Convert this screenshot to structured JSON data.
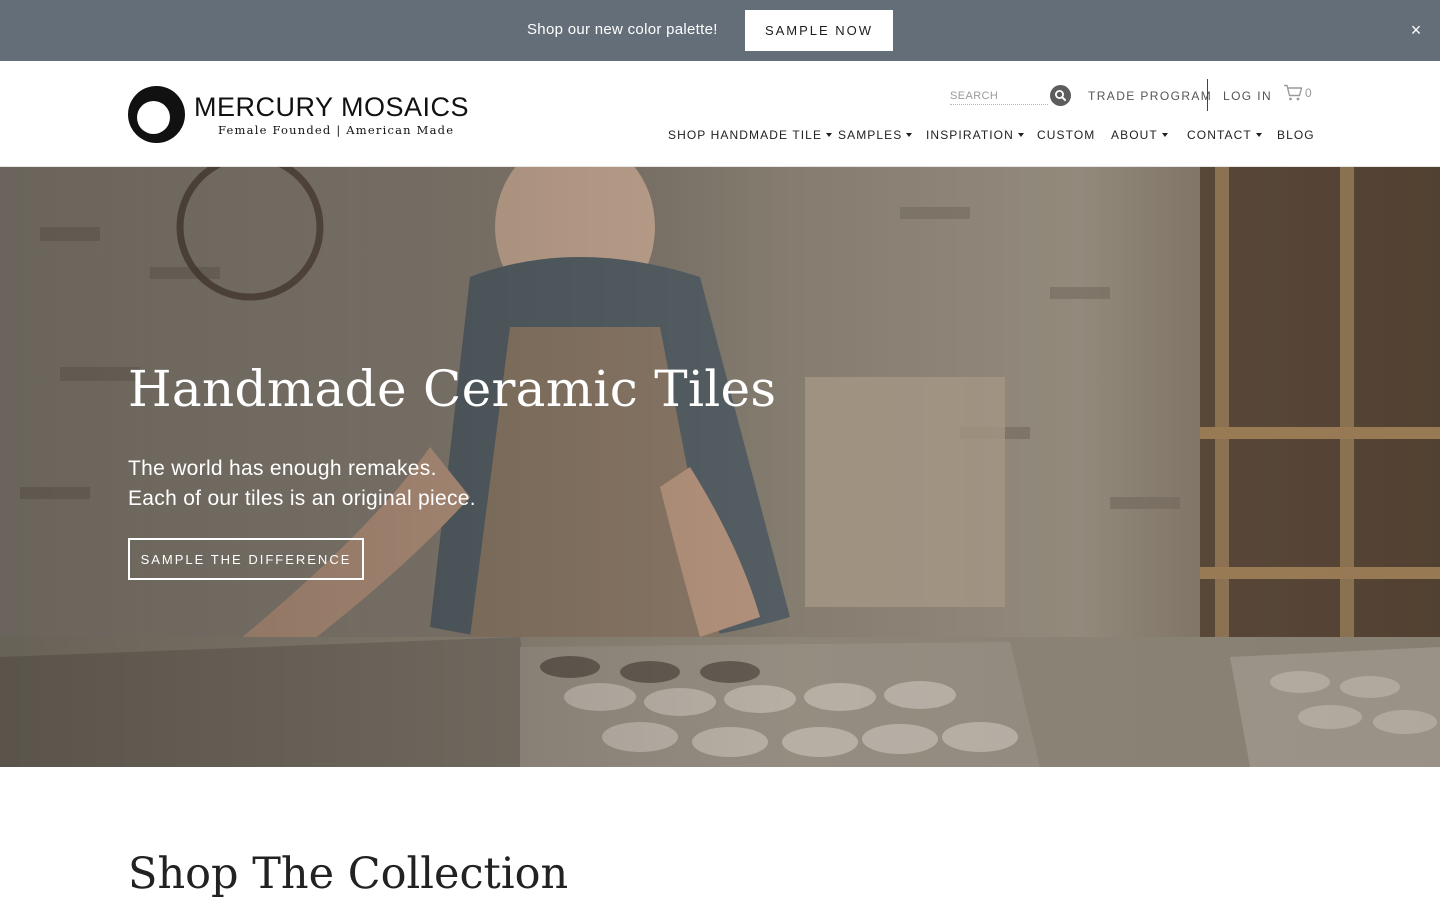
{
  "announcement": {
    "text": "Shop our new color palette!",
    "button_label": "SAMPLE NOW",
    "close_symbol": "×"
  },
  "header": {
    "logo": {
      "name": "MERCURY MOSAICS",
      "tagline": "Female Founded | American Made"
    },
    "search": {
      "placeholder": "SEARCH",
      "icon": "search-icon"
    },
    "top_links": {
      "trade_program": "TRADE PROGRAM",
      "log_in": "LOG IN"
    },
    "cart": {
      "icon": "cart-icon",
      "count": "0"
    },
    "nav": [
      {
        "label": "SHOP HANDMADE TILE",
        "has_dropdown": true
      },
      {
        "label": "SAMPLES",
        "has_dropdown": true
      },
      {
        "label": "INSPIRATION",
        "has_dropdown": true
      },
      {
        "label": "CUSTOM",
        "has_dropdown": false
      },
      {
        "label": "ABOUT",
        "has_dropdown": true
      },
      {
        "label": "CONTACT",
        "has_dropdown": true
      },
      {
        "label": "BLOG",
        "has_dropdown": false
      }
    ]
  },
  "hero": {
    "title": "Handmade Ceramic Tiles",
    "subtitle_line1": "The world has enough remakes.",
    "subtitle_line2": "Each of our tiles is an original piece.",
    "button_label": "SAMPLE THE DIFFERENCE"
  },
  "collection": {
    "title": "Shop The Collection"
  },
  "colors": {
    "announcement_bg": "#646e79",
    "text_dark": "#222222",
    "white": "#ffffff"
  }
}
